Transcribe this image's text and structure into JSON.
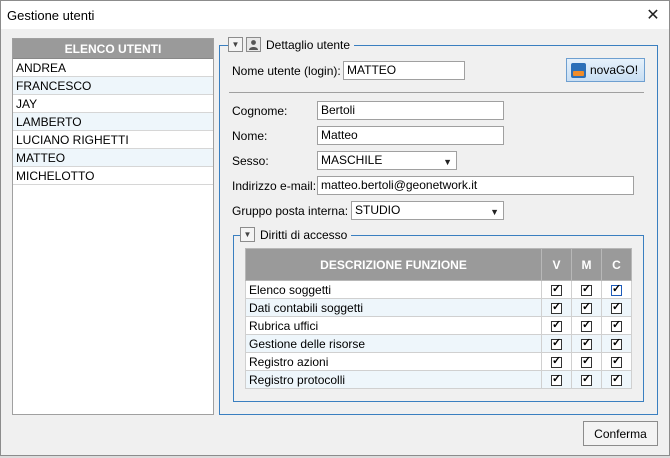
{
  "window": {
    "title": "Gestione utenti"
  },
  "users": {
    "header": "ELENCO UTENTI",
    "items": [
      "ANDREA",
      "FRANCESCO",
      "JAY",
      "LAMBERTO",
      "LUCIANO RIGHETTI",
      "MATTEO",
      "MICHELOTTO"
    ]
  },
  "detail": {
    "legend": "Dettaglio utente",
    "username_label": "Nome utente (login):",
    "username_value": "MATTEO",
    "novago_label": "novaGO!",
    "cognome_label": "Cognome:",
    "cognome_value": "Bertoli",
    "nome_label": "Nome:",
    "nome_value": "Matteo",
    "sesso_label": "Sesso:",
    "sesso_value": "MASCHILE",
    "email_label": "Indirizzo e-mail:",
    "email_value": "matteo.bertoli@geonetwork.it",
    "gruppo_label": "Gruppo posta interna:",
    "gruppo_value": "STUDIO"
  },
  "rights": {
    "legend": "Diritti di accesso",
    "columns": {
      "desc": "DESCRIZIONE FUNZIONE",
      "v": "V",
      "m": "M",
      "c": "C"
    },
    "rows": [
      {
        "label": "Elenco soggetti",
        "v": true,
        "m": true,
        "c": true
      },
      {
        "label": "Dati contabili soggetti",
        "v": true,
        "m": true,
        "c": true
      },
      {
        "label": "Rubrica uffici",
        "v": true,
        "m": true,
        "c": true
      },
      {
        "label": "Gestione delle risorse",
        "v": true,
        "m": true,
        "c": true
      },
      {
        "label": "Registro azioni",
        "v": true,
        "m": true,
        "c": true
      },
      {
        "label": "Registro protocolli",
        "v": true,
        "m": true,
        "c": true
      }
    ]
  },
  "footer": {
    "confirm_label": "Conferma"
  },
  "colors": {
    "accent": "#3a7fc0",
    "header_gray": "#9a9a9a",
    "alt_row": "#eef6fb"
  }
}
